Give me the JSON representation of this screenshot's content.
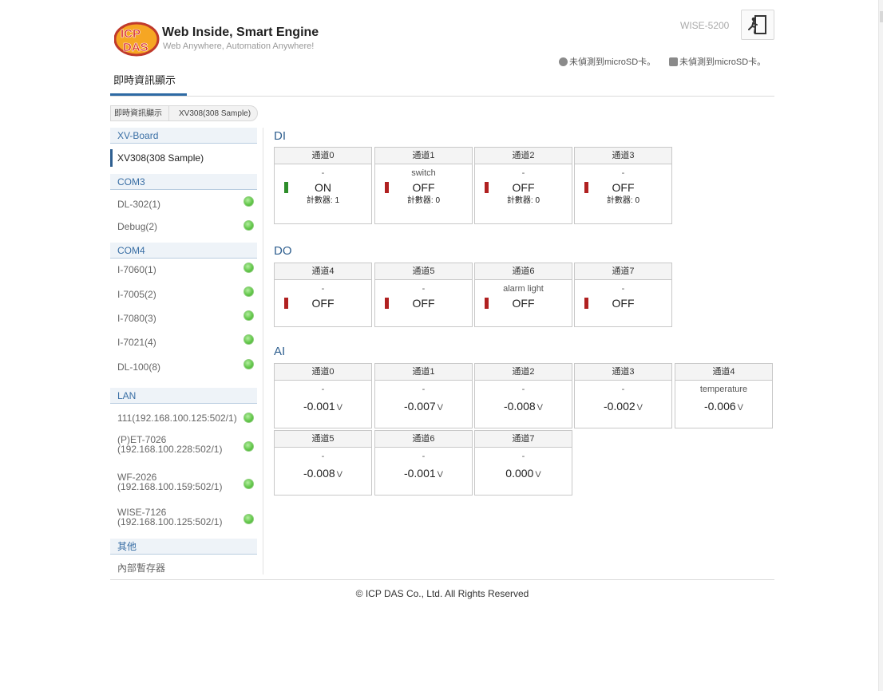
{
  "header": {
    "brand_logo_text": "ICP DAS",
    "brand_title": "Web Inside, Smart Engine",
    "brand_subtitle": "Web Anywhere, Automation Anywhere!",
    "model": "WISE-5200",
    "sd_status_1": "未偵測到microSD卡。",
    "sd_status_2": "未偵測到microSD卡。",
    "nav_tab": "即時資訊顯示"
  },
  "breadcrumb": {
    "root": "即時資訊顯示",
    "current": "XV308(308 Sample)"
  },
  "sidebar": {
    "xv_board": "XV-Board",
    "xv308": "XV308(308 Sample)",
    "com3": "COM3",
    "dl302": "DL-302(1)",
    "debug": "Debug(2)",
    "com4": "COM4",
    "i7060": "I-7060(1)",
    "i7005": "I-7005(2)",
    "i7080": "I-7080(3)",
    "i7021": "I-7021(4)",
    "dl100": "DL-100(8)",
    "lan": "LAN",
    "lan1": "111(192.168.100.125:502/1)",
    "lan2_line1": "(P)ET-7026",
    "lan2_line2": "(192.168.100.228:502/1)",
    "lan3_line1": "WF-2026",
    "lan3_line2": "(192.168.100.159:502/1)",
    "lan4_line1": "WISE-7126",
    "lan4_line2": "(192.168.100.125:502/1)",
    "other": "其他",
    "internal_register": "內部暫存器"
  },
  "di": {
    "title": "DI",
    "channels": [
      {
        "head": "通道0",
        "name": "-",
        "state": "ON",
        "counter": "計數器: 1"
      },
      {
        "head": "通道1",
        "name": "switch",
        "state": "OFF",
        "counter": "計數器: 0"
      },
      {
        "head": "通道2",
        "name": "-",
        "state": "OFF",
        "counter": "計數器: 0"
      },
      {
        "head": "通道3",
        "name": "-",
        "state": "OFF",
        "counter": "計數器: 0"
      }
    ]
  },
  "do": {
    "title": "DO",
    "channels": [
      {
        "head": "通道4",
        "name": "-",
        "state": "OFF"
      },
      {
        "head": "通道5",
        "name": "-",
        "state": "OFF"
      },
      {
        "head": "通道6",
        "name": "alarm light",
        "state": "OFF"
      },
      {
        "head": "通道7",
        "name": "-",
        "state": "OFF"
      }
    ]
  },
  "ai": {
    "title": "AI",
    "unit": "V",
    "channels": [
      {
        "head": "通道0",
        "name": "-",
        "value": "-0.001"
      },
      {
        "head": "通道1",
        "name": "-",
        "value": "-0.007"
      },
      {
        "head": "通道2",
        "name": "-",
        "value": "-0.008"
      },
      {
        "head": "通道3",
        "name": "-",
        "value": "-0.002"
      },
      {
        "head": "通道4",
        "name": "temperature",
        "value": "-0.006"
      },
      {
        "head": "通道5",
        "name": "-",
        "value": "-0.008"
      },
      {
        "head": "通道6",
        "name": "-",
        "value": "-0.001"
      },
      {
        "head": "通道7",
        "name": "-",
        "value": "0.000"
      }
    ]
  },
  "footer": {
    "copyright": "© ICP DAS Co., Ltd. All Rights Reserved"
  },
  "colors": {
    "accent": "#2e6aa4",
    "status_on": "#2d8d2a",
    "status_off": "#b02020",
    "led_green": "#66c94e"
  },
  "icons": {
    "logout": "exit-door-icon",
    "sd_card_1": "sd-card-icon",
    "sd_card_2": "sd-card-icon",
    "link_status": "green-led-icon"
  }
}
